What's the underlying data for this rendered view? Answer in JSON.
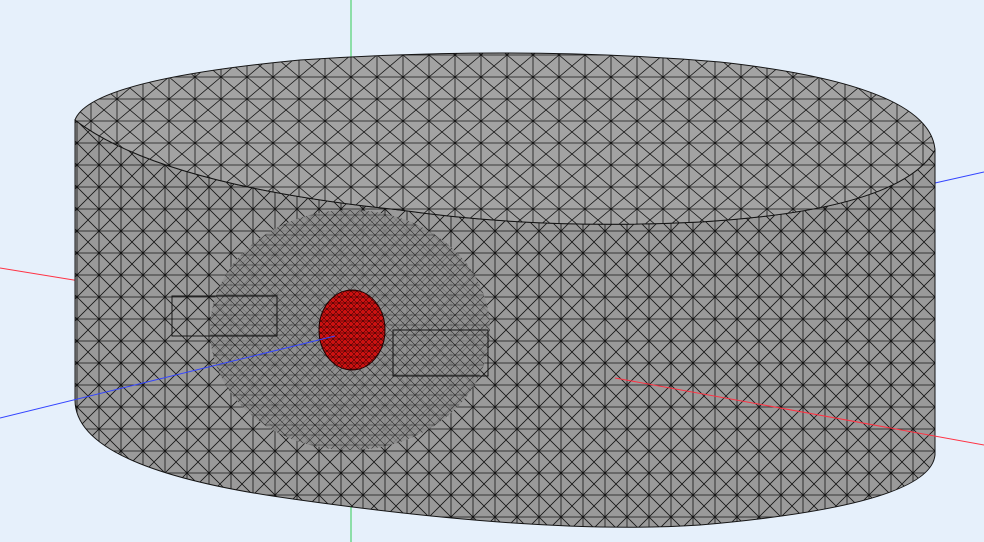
{
  "viewport": {
    "background": "#e6f0fb"
  },
  "axes": {
    "x_color": "#ff3344",
    "y_color": "#33cc55",
    "z_color": "#3344ff"
  },
  "mesh": {
    "surface_color": "#a3a3a3",
    "side_color": "#9a9a9a",
    "edge_color": "#141414"
  },
  "highlight": {
    "color": "#cc1111"
  }
}
